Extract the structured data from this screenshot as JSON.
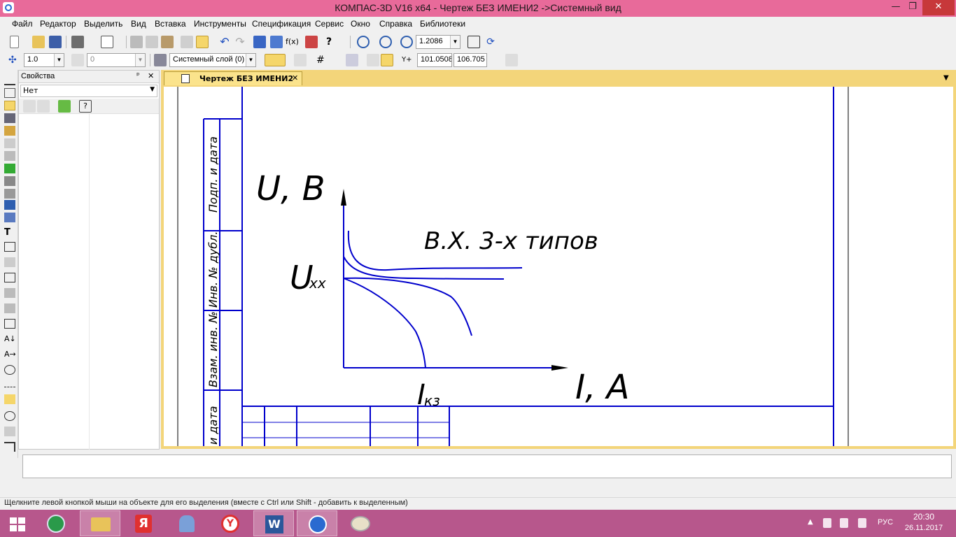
{
  "window": {
    "title": "КОМПАС-3D V16  x64 - Чертеж БЕЗ ИМЕНИ2 ->Системный вид",
    "minimize_glyph": "—",
    "restore_glyph": "❐",
    "close_glyph": "✕"
  },
  "menu": [
    "Файл",
    "Редактор",
    "Выделить",
    "Вид",
    "Вставка",
    "Инструменты",
    "Спецификация",
    "Сервис",
    "Окно",
    "Справка",
    "Библиотеки"
  ],
  "toolbar1": {
    "zoom_value": "1.2086"
  },
  "toolbar2": {
    "step_value": "1.0",
    "angle_value": "0",
    "layer_value": "Системный слой (0)",
    "coord_x": "101.0508",
    "coord_y": "106.705"
  },
  "properties": {
    "title": "Свойства",
    "pin_glyph": "ᵖ",
    "close_glyph": "✕",
    "selection": "Нет"
  },
  "document": {
    "tab_label": "Чертеж БЕЗ ИМЕНИ2",
    "tab_close": "✕"
  },
  "drawing": {
    "y_axis_label": "U, В",
    "x_axis_label": "I, А",
    "uxx_main": "U",
    "uxx_sub": "хх",
    "ikz_main": "I",
    "ikz_sub": "кз",
    "curves_caption": "В.Х. 3-х типов",
    "stamp_labels": [
      "Подп. и дата",
      "Инв. № дубл.",
      "Взам. инв. №",
      "и дата"
    ]
  },
  "status": {
    "hint": "Щелкните левой кнопкой мыши на объекте для его выделения (вместе с Ctrl или Shift - добавить к выделенным)"
  },
  "taskbar": {
    "lang": "РУС",
    "time": "20:30",
    "date": "26.11.2017"
  },
  "colors": {
    "titlebar": "#e86a9a",
    "taskbar": "#b7578c",
    "drawing_blue": "#0000cc",
    "doc_tab": "#fbe38c"
  }
}
